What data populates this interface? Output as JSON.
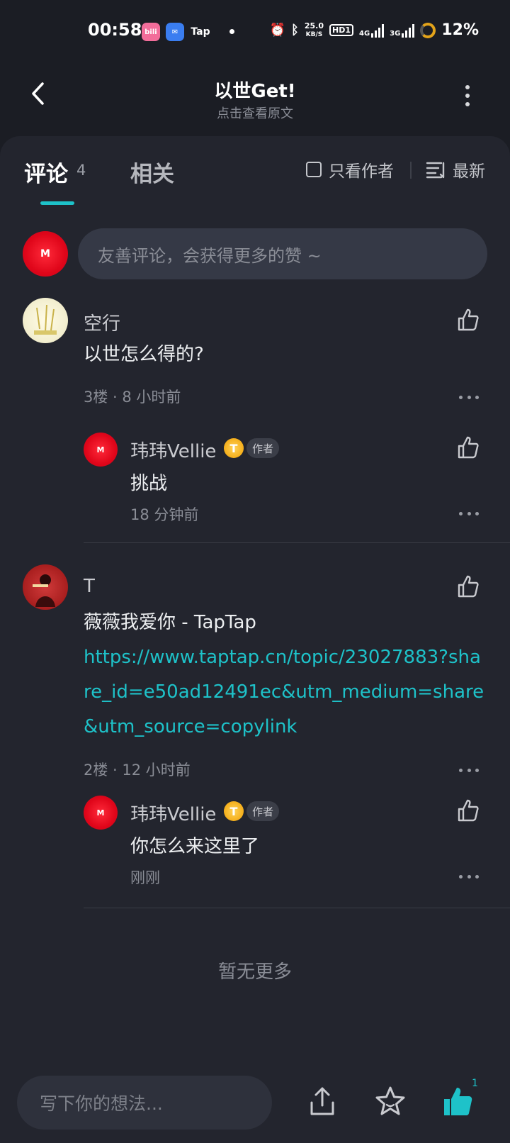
{
  "status_bar": {
    "time": "00:58",
    "apps": [
      "bili",
      "mail",
      "Tap"
    ],
    "net_speed_value": "25.0",
    "net_speed_unit": "KB/S",
    "hd": "HD1",
    "net_4g": "4G",
    "net_3g": "3G",
    "battery": "12%"
  },
  "header": {
    "title": "以世Get!",
    "subtitle": "点击查看原文"
  },
  "tabs": {
    "comments_label": "评论",
    "comments_count": "4",
    "related_label": "相关",
    "author_only_label": "只看作者",
    "sort_label": "最新"
  },
  "compose": {
    "avatar_text": "M",
    "placeholder": "友善评论，会获得更多的赞 ~"
  },
  "comments": [
    {
      "name": "空行",
      "text": "以世怎么得的?",
      "meta": "3楼 · 8 小时前",
      "reply": {
        "name": "玮玮Vellie",
        "badge_coin": "T",
        "badge_author": "作者",
        "text": "挑战",
        "meta": "18 分钟前"
      }
    },
    {
      "name": "T",
      "text": "薇薇我爱你 - TapTap",
      "link": "https://www.taptap.cn/topic/23027883?share_id=e50ad12491ec&utm_medium=share&utm_source=copylink",
      "meta": "2楼 · 12 小时前",
      "reply": {
        "name": "玮玮Vellie",
        "badge_coin": "T",
        "badge_author": "作者",
        "text": "你怎么来这里了",
        "meta": "刚刚"
      }
    }
  ],
  "no_more": "暂无更多",
  "bottom_bar": {
    "placeholder": "写下你的想法...",
    "like_count": "1"
  },
  "colors": {
    "accent": "#1ec2c9",
    "background": "#23252e",
    "avatar_red": "#e0061a"
  }
}
